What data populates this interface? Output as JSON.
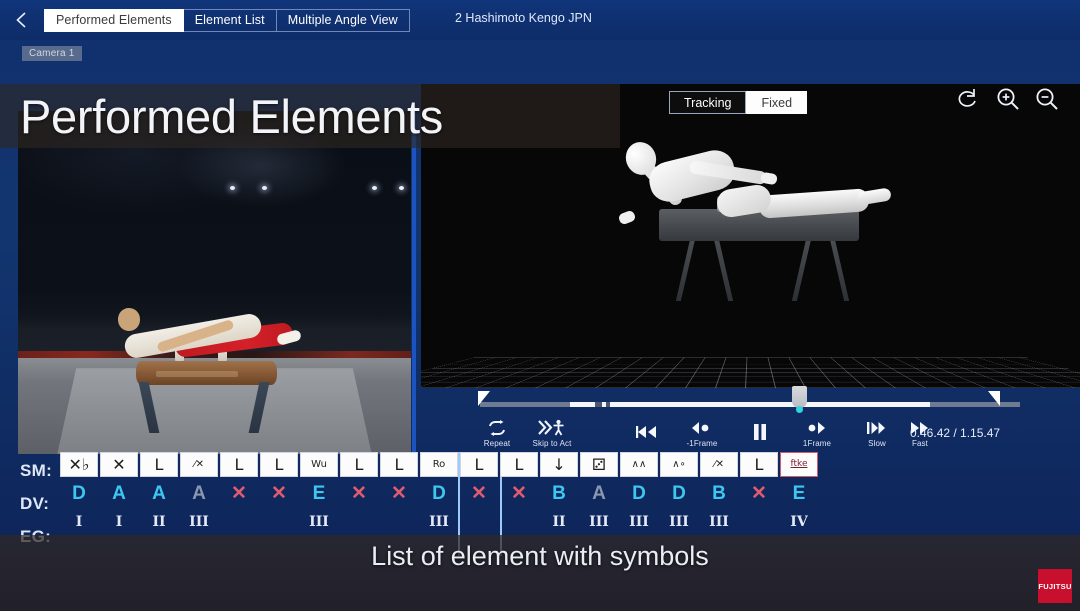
{
  "header": {
    "back_icon": "chevron-left-icon",
    "tabs": [
      {
        "label": "Performed Elements",
        "active": true
      },
      {
        "label": "Element List",
        "active": false
      },
      {
        "label": "Multiple Angle View",
        "active": false
      }
    ],
    "athlete": "2 Hashimoto Kengo JPN"
  },
  "left_pane": {
    "camera_badge": "Camera 1"
  },
  "viewer": {
    "view_modes": [
      {
        "label": "Tracking",
        "selected": true
      },
      {
        "label": "Fixed",
        "selected": false
      }
    ],
    "tools": [
      {
        "name": "reset-rotation-icon",
        "label": "Reset"
      },
      {
        "name": "zoom-in-icon",
        "label": "Zoom In"
      },
      {
        "name": "zoom-out-icon",
        "label": "Zoom Out"
      }
    ]
  },
  "captions": {
    "top": "Performed Elements",
    "bottom": "List of element with symbols"
  },
  "player": {
    "timecode": "0.46.42 / 1.15.47",
    "current_time": "0.46.42",
    "total_time": "1.15.47",
    "controls": [
      {
        "name": "repeat-button",
        "label": "Repeat",
        "glyph": "repeat"
      },
      {
        "name": "skip-to-act-button",
        "label": "Skip to Act",
        "glyph": "skipact"
      },
      {
        "name": "rewind-button",
        "label": "",
        "glyph": "rewind"
      },
      {
        "name": "prev-frame-button",
        "label": "-1Frame",
        "glyph": "prevframe"
      },
      {
        "name": "pause-button",
        "label": "",
        "glyph": "pause"
      },
      {
        "name": "next-frame-button",
        "label": "1Frame",
        "glyph": "nextframe"
      },
      {
        "name": "slow-button",
        "label": "Slow",
        "glyph": "slow"
      },
      {
        "name": "fast-button",
        "label": "Fast",
        "glyph": "fast"
      }
    ]
  },
  "element_table": {
    "row_labels": {
      "sm": "SM:",
      "dv": "DV:",
      "eg": "EG:"
    },
    "selected_index": 10,
    "colors": {
      "cyan": "#3ec8f0",
      "grey": "#8a98ae",
      "red": "#e05a72"
    },
    "columns": [
      {
        "symbol": "✕♭",
        "symbol_class": "sym",
        "dv": "D",
        "dv_color": "cyan",
        "eg": "I"
      },
      {
        "symbol": "✕",
        "symbol_class": "sym",
        "dv": "A",
        "dv_color": "cyan",
        "eg": "I"
      },
      {
        "symbol": "L",
        "symbol_class": "sym",
        "dv": "A",
        "dv_color": "cyan",
        "eg": "II"
      },
      {
        "symbol": "⁄✕",
        "symbol_class": "sym small",
        "dv": "A",
        "dv_color": "grey",
        "eg": "III"
      },
      {
        "symbol": "L",
        "symbol_class": "sym",
        "dv": "✕",
        "dv_color": "red",
        "eg": ""
      },
      {
        "symbol": "L",
        "symbol_class": "sym",
        "dv": "✕",
        "dv_color": "red",
        "eg": ""
      },
      {
        "symbol": "Wu",
        "symbol_class": "sym small",
        "dv": "E",
        "dv_color": "cyan",
        "eg": "III"
      },
      {
        "symbol": "L",
        "symbol_class": "sym",
        "dv": "✕",
        "dv_color": "red",
        "eg": ""
      },
      {
        "symbol": "L",
        "symbol_class": "sym",
        "dv": "✕",
        "dv_color": "red",
        "eg": ""
      },
      {
        "symbol": "Ro",
        "symbol_class": "sym small",
        "dv": "D",
        "dv_color": "cyan",
        "eg": "III"
      },
      {
        "symbol": "L",
        "symbol_class": "sym",
        "dv": "✕",
        "dv_color": "red",
        "eg": ""
      },
      {
        "symbol": "L",
        "symbol_class": "sym",
        "dv": "✕",
        "dv_color": "red",
        "eg": ""
      },
      {
        "symbol": "↓",
        "symbol_class": "sym",
        "dv": "B",
        "dv_color": "cyan",
        "eg": "II"
      },
      {
        "symbol": "⚂",
        "symbol_class": "sym",
        "dv": "A",
        "dv_color": "grey",
        "eg": "III"
      },
      {
        "symbol": "∧∧",
        "symbol_class": "sym small",
        "dv": "D",
        "dv_color": "cyan",
        "eg": "III"
      },
      {
        "symbol": "∧∘",
        "symbol_class": "sym small",
        "dv": "D",
        "dv_color": "cyan",
        "eg": "III"
      },
      {
        "symbol": "⁄✕",
        "symbol_class": "sym small",
        "dv": "B",
        "dv_color": "cyan",
        "eg": "III"
      },
      {
        "symbol": "L",
        "symbol_class": "sym",
        "dv": "✕",
        "dv_color": "red",
        "eg": ""
      },
      {
        "symbol": "ftke",
        "symbol_class": "sym tiny",
        "dv": "E",
        "dv_color": "cyan",
        "eg": "IV",
        "boxed": true
      }
    ]
  },
  "branding": {
    "logo": "FUJITSU"
  }
}
